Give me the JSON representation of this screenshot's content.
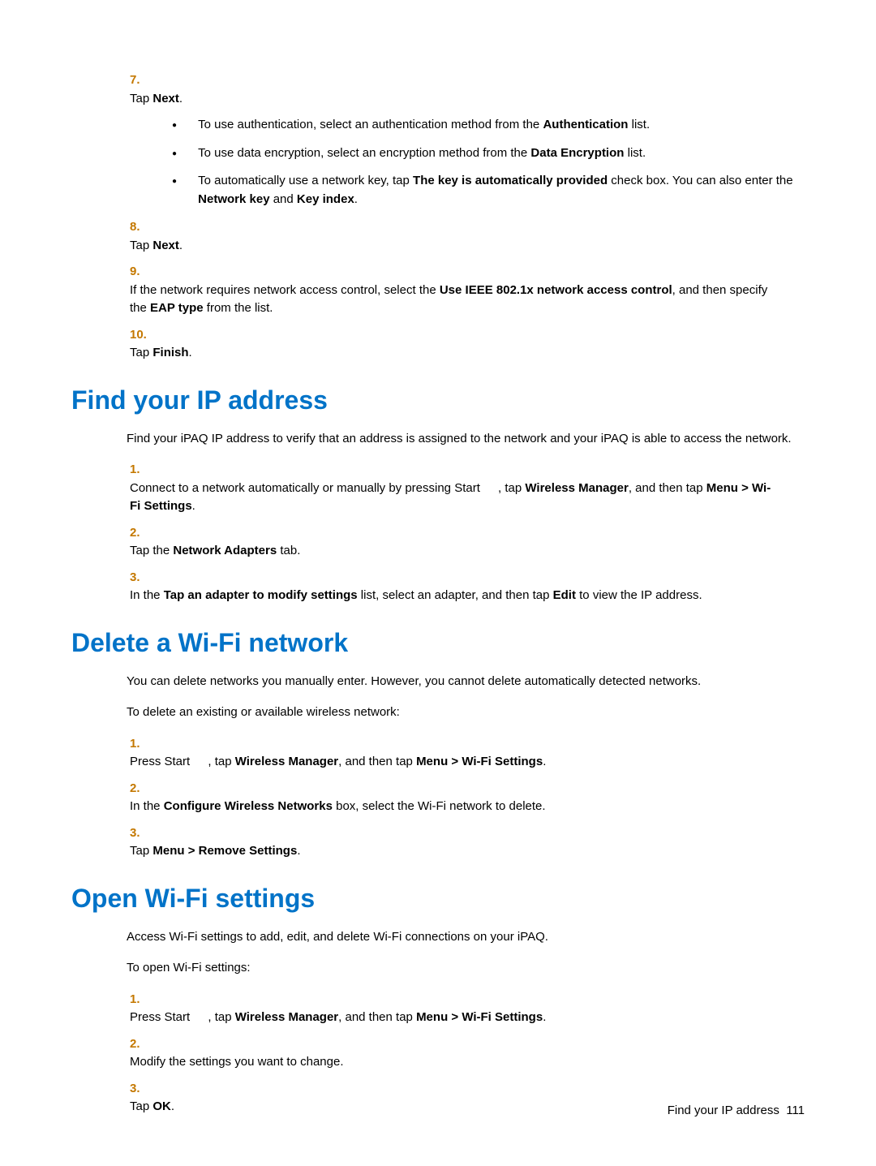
{
  "steps_top": {
    "n7": "7.",
    "s7_pre": "Tap ",
    "s7_b": "Next",
    "s7_post": ".",
    "b1_pre": "To use authentication, select an authentication method from the ",
    "b1_b": "Authentication",
    "b1_post": " list.",
    "b2_pre": "To use data encryption, select an encryption method from the ",
    "b2_b": "Data Encryption",
    "b2_post": " list.",
    "b3_pre": "To automatically use a network key, tap ",
    "b3_b1": "The key is automatically provided",
    "b3_mid1": " check box. You can also enter the ",
    "b3_b2": "Network key",
    "b3_mid2": " and ",
    "b3_b3": "Key index",
    "b3_post": ".",
    "n8": "8.",
    "s8_pre": "Tap ",
    "s8_b": "Next",
    "s8_post": ".",
    "n9": "9.",
    "s9_pre": "If the network requires network access control, select the ",
    "s9_b1": "Use IEEE 802.1x network access control",
    "s9_mid": ", and then specify the ",
    "s9_b2": "EAP type",
    "s9_post": " from the list.",
    "n10": "10.",
    "s10_pre": "Tap ",
    "s10_b": "Finish",
    "s10_post": "."
  },
  "sec1": {
    "title": "Find your IP address",
    "p1": "Find your iPAQ IP address to verify that an address is assigned to the network and your iPAQ is able to access the network.",
    "n1": "1.",
    "s1_pre": "Connect to a network automatically or manually by pressing Start ",
    "s1_mid": ", tap ",
    "s1_b1": "Wireless Manager",
    "s1_mid2": ", and then tap ",
    "s1_b2": "Menu > Wi-Fi Settings",
    "s1_post": ".",
    "n2": "2.",
    "s2_pre": "Tap the ",
    "s2_b": "Network Adapters",
    "s2_post": " tab.",
    "n3": "3.",
    "s3_pre": "In the ",
    "s3_b1": "Tap an adapter to modify settings",
    "s3_mid": " list, select an adapter, and then tap ",
    "s3_b2": "Edit",
    "s3_post": " to view the IP address."
  },
  "sec2": {
    "title": "Delete a Wi-Fi network",
    "p1": "You can delete networks you manually enter. However, you cannot delete automatically detected networks.",
    "p2": "To delete an existing or available wireless network:",
    "n1": "1.",
    "s1_pre": "Press Start ",
    "s1_mid": ", tap ",
    "s1_b1": "Wireless Manager",
    "s1_mid2": ", and then tap ",
    "s1_b2": "Menu > Wi-Fi Settings",
    "s1_post": ".",
    "n2": "2.",
    "s2_pre": "In the ",
    "s2_b": "Configure Wireless Networks",
    "s2_post": " box, select the Wi-Fi network to delete.",
    "n3": "3.",
    "s3_pre": "Tap ",
    "s3_b": "Menu > Remove Settings",
    "s3_post": "."
  },
  "sec3": {
    "title": "Open Wi-Fi settings",
    "p1": "Access Wi-Fi settings to add, edit, and delete Wi-Fi connections on your iPAQ.",
    "p2": "To open Wi-Fi settings:",
    "n1": "1.",
    "s1_pre": "Press Start ",
    "s1_mid": ", tap ",
    "s1_b1": "Wireless Manager",
    "s1_mid2": ", and then tap ",
    "s1_b2": "Menu > Wi-Fi Settings",
    "s1_post": ".",
    "n2": "2.",
    "s2": "Modify the settings you want to change.",
    "n3": "3.",
    "s3_pre": "Tap ",
    "s3_b": "OK",
    "s3_post": "."
  },
  "footer": {
    "text": "Find your IP address",
    "page": "111"
  }
}
